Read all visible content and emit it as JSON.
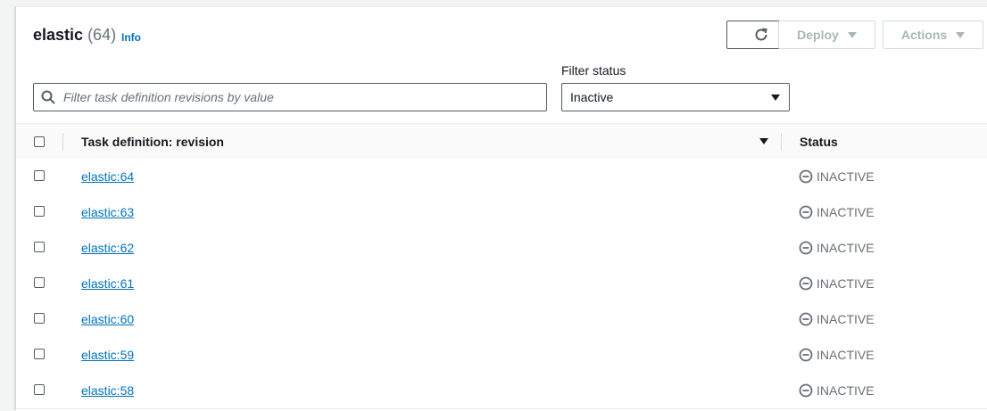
{
  "header": {
    "title": "elastic",
    "count": "(64)",
    "info_label": "Info"
  },
  "toolbar": {
    "refresh_icon": "refresh-icon",
    "deploy_label": "Deploy",
    "actions_label": "Actions"
  },
  "search": {
    "placeholder": "Filter task definition revisions by value"
  },
  "filter": {
    "label": "Filter status",
    "selected": "Inactive"
  },
  "table": {
    "columns": [
      "Task definition: revision",
      "Status"
    ],
    "rows": [
      {
        "revision": "elastic:64",
        "status": "INACTIVE"
      },
      {
        "revision": "elastic:63",
        "status": "INACTIVE"
      },
      {
        "revision": "elastic:62",
        "status": "INACTIVE"
      },
      {
        "revision": "elastic:61",
        "status": "INACTIVE"
      },
      {
        "revision": "elastic:60",
        "status": "INACTIVE"
      },
      {
        "revision": "elastic:59",
        "status": "INACTIVE"
      },
      {
        "revision": "elastic:58",
        "status": "INACTIVE"
      }
    ]
  },
  "colors": {
    "link": "#0073bb",
    "status_gray": "#687078",
    "border": "#d5dbdb"
  }
}
